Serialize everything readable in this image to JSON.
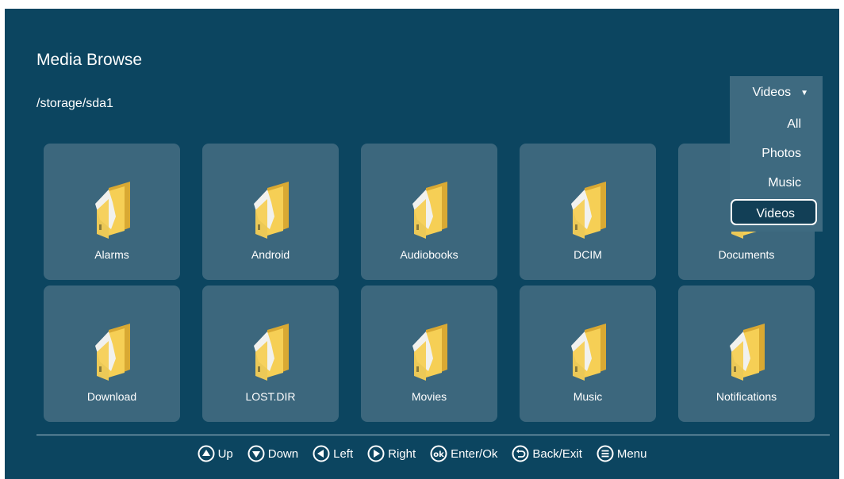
{
  "header": {
    "title": "Media Browse",
    "path": "/storage/sda1"
  },
  "filter": {
    "selected": "Videos",
    "options": [
      "All",
      "Photos",
      "Music",
      "Videos"
    ],
    "highlighted_index": 3
  },
  "folders": [
    {
      "label": "Alarms"
    },
    {
      "label": "Android"
    },
    {
      "label": "Audiobooks"
    },
    {
      "label": "DCIM"
    },
    {
      "label": "Documents"
    },
    {
      "label": "Download"
    },
    {
      "label": "LOST.DIR"
    },
    {
      "label": "Movies"
    },
    {
      "label": "Music"
    },
    {
      "label": "Notifications"
    }
  ],
  "footer": {
    "hints": [
      {
        "icon": "up-icon",
        "label": "Up"
      },
      {
        "icon": "down-icon",
        "label": "Down"
      },
      {
        "icon": "left-icon",
        "label": "Left"
      },
      {
        "icon": "right-icon",
        "label": "Right"
      },
      {
        "icon": "ok-icon",
        "label": "Enter/Ok"
      },
      {
        "icon": "back-icon",
        "label": "Back/Exit"
      },
      {
        "icon": "menu-icon",
        "label": "Menu"
      }
    ]
  },
  "colors": {
    "background": "#0c4560",
    "tile": "#3c677d",
    "folder_yellow": "#f6cf55",
    "folder_dark": "#d9a933",
    "paper": "#f1f1ee"
  }
}
